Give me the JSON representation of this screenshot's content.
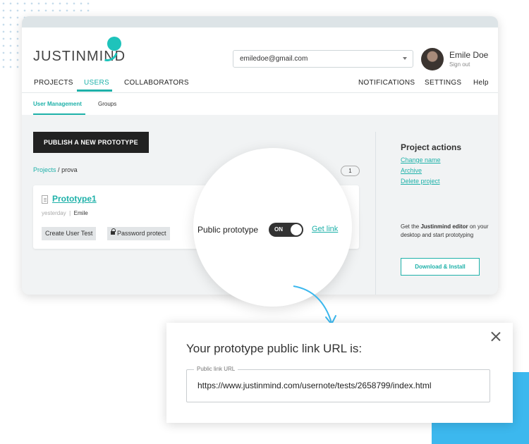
{
  "header": {
    "logo": "JUSTINMIND",
    "account_select": "emiledoe@gmail.com",
    "user_name": "Emile Doe",
    "sign_out": "Sign out"
  },
  "nav": {
    "left": [
      "PROJECTS",
      "USERS",
      "COLLABORATORS"
    ],
    "right": [
      "NOTIFICATIONS",
      "SETTINGS",
      "Help"
    ],
    "active": "USERS"
  },
  "subnav": [
    "User Management",
    "Groups"
  ],
  "main": {
    "publish_button": "PUBLISH A NEW PROTOTYPE",
    "breadcrumb": {
      "root": "Projects",
      "separator": "/",
      "current": "prova"
    },
    "count": "1",
    "prototype": {
      "name": "Prototype1",
      "date": "yesterday",
      "separator": "|",
      "author": "Emile",
      "create_test": "Create User Test",
      "password_protect": "Password protect"
    }
  },
  "project_actions": {
    "title": "Project actions",
    "links": [
      "Change name",
      "Archive",
      "Delete project"
    ],
    "promo_pre": "Get the ",
    "promo_bold": "Justinmind editor",
    "promo_post": " on your desktop and start prototyping",
    "download": "Download & Install"
  },
  "magnifier": {
    "label": "Public prototype",
    "toggle_state": "ON",
    "get_link": "Get link"
  },
  "modal": {
    "title": "Your prototype public link URL is:",
    "field_label": "Public link URL",
    "url": "https://www.justinmind.com/usernote/tests/2658799/index.html"
  },
  "colors": {
    "accent": "#1eb1a9",
    "decor_blue": "#3cb8ee",
    "dark_button": "#222222"
  }
}
